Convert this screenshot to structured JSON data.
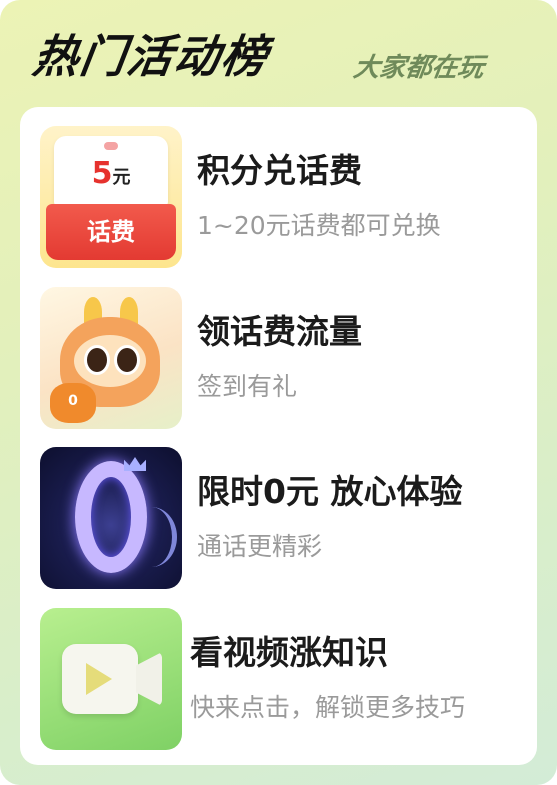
{
  "header": {
    "title": "热门活动榜",
    "subtitle": "大家都在玩"
  },
  "items": [
    {
      "title": "积分兑话费",
      "subtitle": "1~20元话费都可兑换",
      "thumb": {
        "icon": "phone-fee-voucher-icon",
        "amount": "5",
        "unit": "元",
        "label": "话费"
      }
    },
    {
      "title": "领话费流量",
      "subtitle": "签到有礼",
      "thumb": {
        "icon": "dragon-mascot-icon",
        "badge": "0"
      }
    },
    {
      "title": "限时0元 放心体验",
      "subtitle": "通话更精彩",
      "thumb": {
        "icon": "glowing-zero-icon"
      }
    },
    {
      "title": "看视频涨知识",
      "subtitle": "快来点击，解锁更多技巧",
      "thumb": {
        "icon": "video-camera-icon"
      }
    }
  ],
  "colors": {
    "background_start": "#ecf3b5",
    "background_end": "#d3ecd7",
    "title_text": "#1b1b1b",
    "subtitle_text": "#9a9a9a",
    "voucher_red": "#e33a32"
  }
}
